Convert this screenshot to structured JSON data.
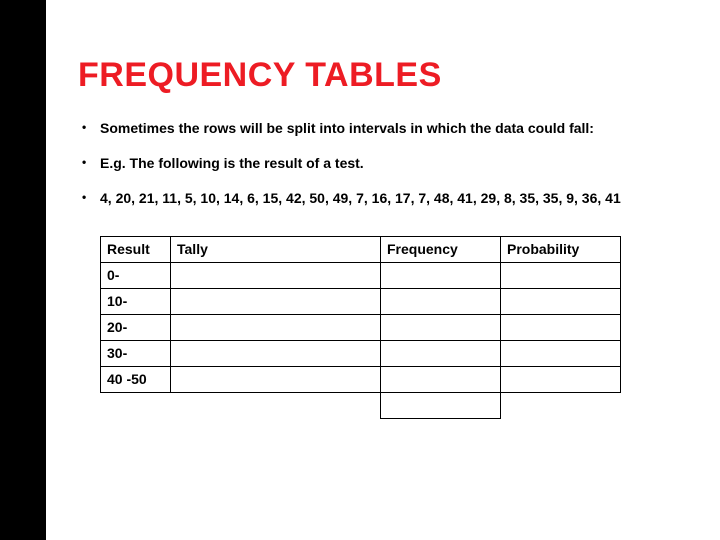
{
  "title": "FREQUENCY TABLES",
  "bullets": [
    "Sometimes the rows will be split into intervals in which the data could fall:",
    "E.g. The following is the result of a test.",
    "4, 20, 21, 11, 5, 10, 14, 6, 15, 42, 50, 49, 7, 16, 17, 7, 48, 41, 29,  8, 35, 35, 9, 36, 41"
  ],
  "table": {
    "headers": [
      "Result",
      "Tally",
      "Frequency",
      "Probability"
    ],
    "rows": [
      {
        "result": "0-",
        "tally": "",
        "frequency": "",
        "probability": ""
      },
      {
        "result": "10-",
        "tally": "",
        "frequency": "",
        "probability": ""
      },
      {
        "result": "20-",
        "tally": "",
        "frequency": "",
        "probability": ""
      },
      {
        "result": "30-",
        "tally": "",
        "frequency": "",
        "probability": ""
      },
      {
        "result": "40 -50",
        "tally": "",
        "frequency": "",
        "probability": ""
      }
    ]
  }
}
